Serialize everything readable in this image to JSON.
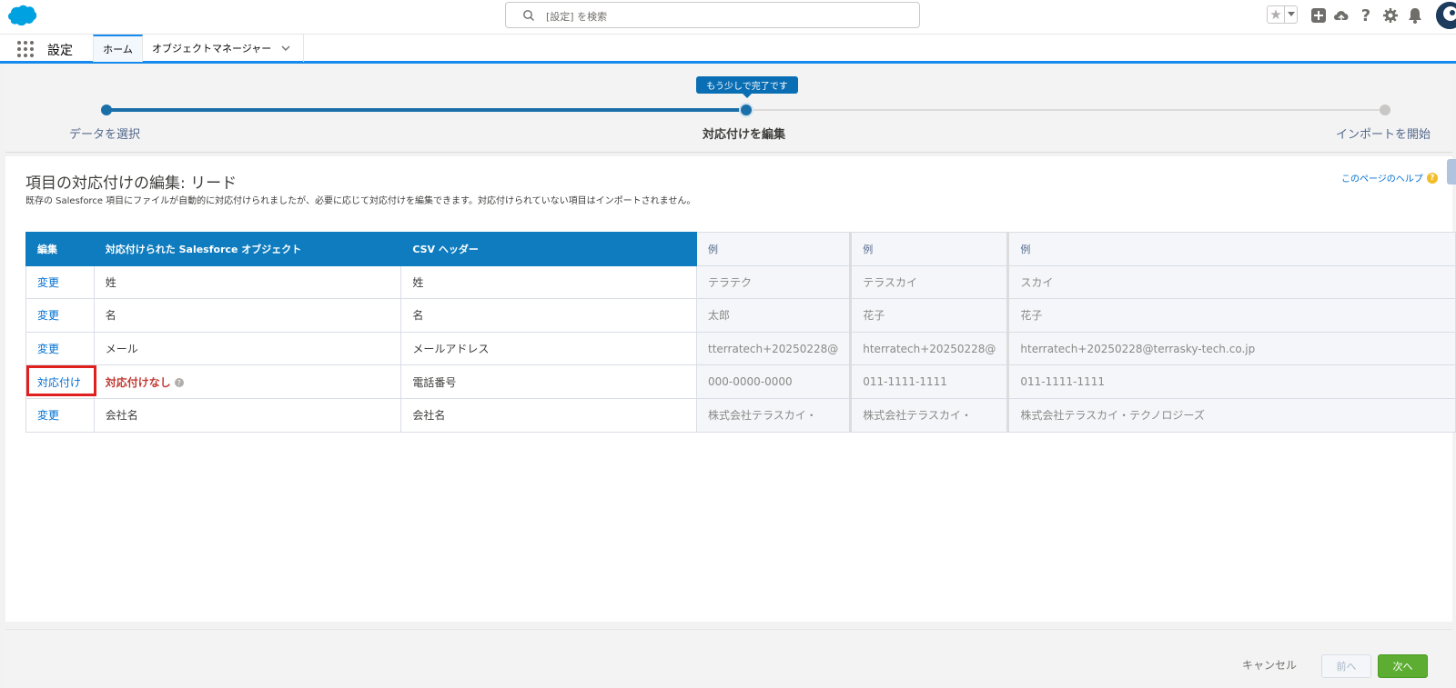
{
  "header": {
    "search_placeholder": "[設定] を検索"
  },
  "context_bar": {
    "app_name": "設定",
    "tabs": [
      {
        "label": "ホーム"
      },
      {
        "label": "オブジェクトマネージャー"
      }
    ]
  },
  "wizard": {
    "tooltip": "もう少しで完了です",
    "steps": [
      {
        "label": "データを選択",
        "state": "done"
      },
      {
        "label": "対応付けを編集",
        "state": "current"
      },
      {
        "label": "インポートを開始",
        "state": "todo"
      }
    ]
  },
  "page": {
    "title": "項目の対応付けの編集: リード",
    "description": "既存の Salesforce 項目にファイルが自動的に対応付けられましたが、必要に応じて対応付けを編集できます。対応付けられていない項目はインポートされません。",
    "help_link": "このページのヘルプ"
  },
  "table": {
    "headers": {
      "edit": "編集",
      "sf_object": "対応付けられた Salesforce オブジェクト",
      "csv_header": "CSV ヘッダー",
      "example1": "例",
      "example2": "例",
      "example3": "例"
    },
    "rows": [
      {
        "action": "変更",
        "sf_field": "姓",
        "csv": "姓",
        "ex1": "テラテク",
        "ex2": "テラスカイ",
        "ex3": "スカイ"
      },
      {
        "action": "変更",
        "sf_field": "名",
        "csv": "名",
        "ex1": "太郎",
        "ex2": "花子",
        "ex3": "花子"
      },
      {
        "action": "変更",
        "sf_field": "メール",
        "csv": "メールアドレス",
        "ex1": "tterratech+20250228@",
        "ex2": "hterratech+20250228@",
        "ex3": "hterratech+20250228@terrasky-tech.co.jp"
      },
      {
        "action": "対応付け",
        "sf_field": "対応付けなし",
        "csv": "電話番号",
        "ex1": "000-0000-0000",
        "ex2": "011-1111-1111",
        "ex3": "011-1111-1111"
      },
      {
        "action": "変更",
        "sf_field": "会社名",
        "csv": "会社名",
        "ex1": "株式会社テラスカイ・",
        "ex2": "株式会社テラスカイ・",
        "ex3": "株式会社テラスカイ・テクノロジーズ"
      }
    ]
  },
  "footer": {
    "cancel": "キャンセル",
    "prev": "前へ",
    "next": "次へ"
  },
  "colors": {
    "brand_blue": "#0e7cbf",
    "next_green": "#5cad31",
    "highlight_red": "#e0201f"
  }
}
